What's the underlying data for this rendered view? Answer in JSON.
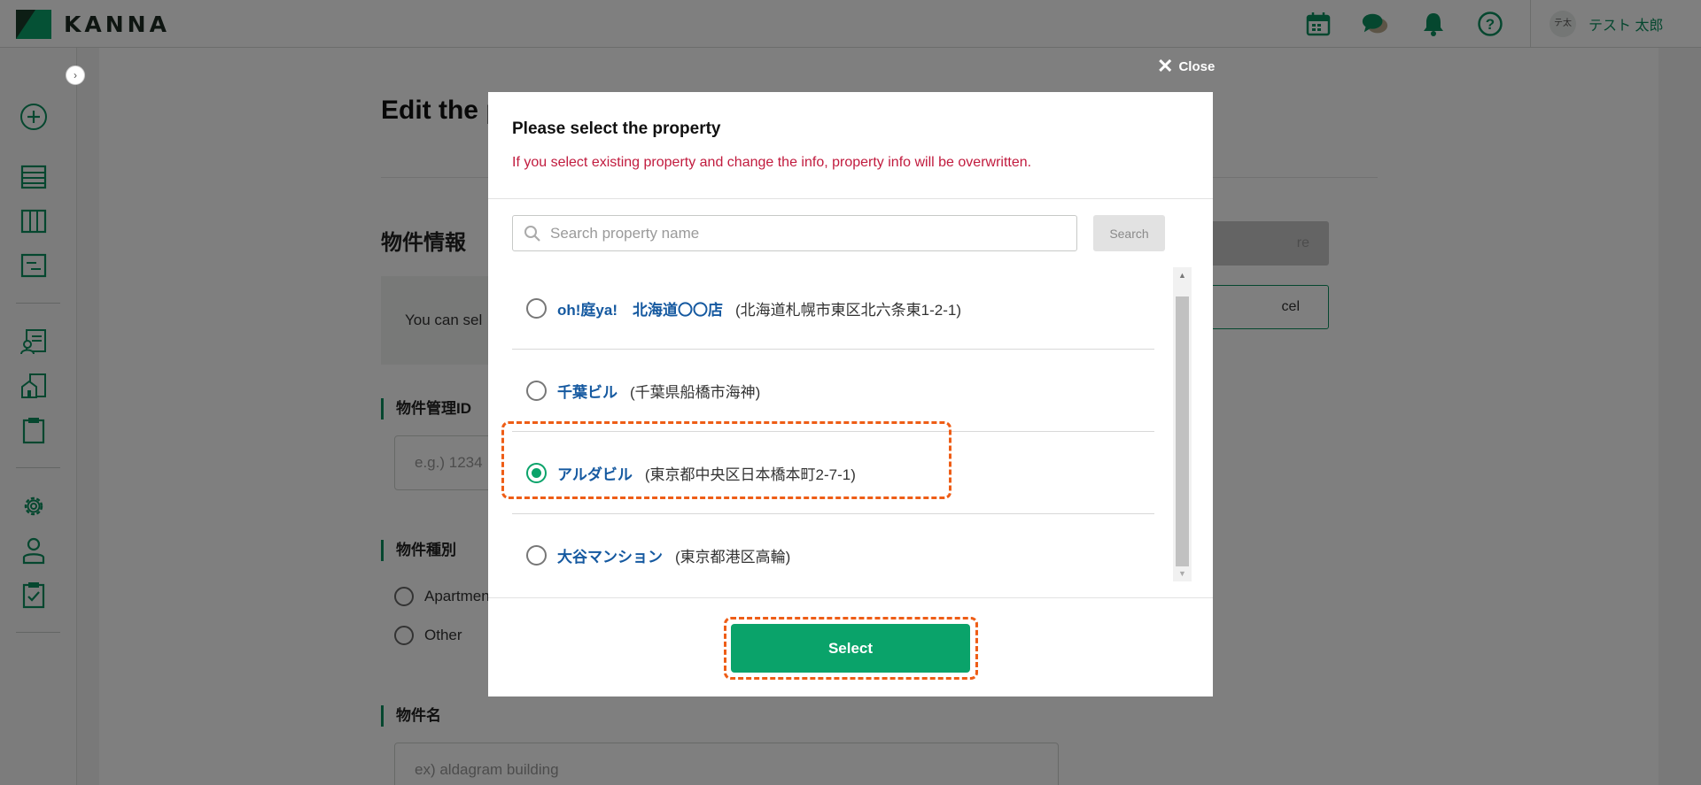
{
  "app": {
    "logo_text": "KANNA"
  },
  "header": {
    "icons": [
      "calendar-icon",
      "chat-icon",
      "bell-icon",
      "help-icon"
    ],
    "user": {
      "avatar_text": "テ太",
      "name": "テスト 太郎"
    }
  },
  "sidebar": {
    "toggle": "›",
    "items": [
      "add-icon",
      "list-icon",
      "board-icon",
      "report-icon",
      "customer-icon",
      "property-icon",
      "clipboard-icon",
      "settings-icon",
      "user-icon",
      "checklist-icon"
    ]
  },
  "page": {
    "title": "Edit the p",
    "section_title": "物件情報",
    "info_text": "You can sel",
    "save_button": "re",
    "cancel_button": "cel",
    "fields": {
      "property_id_label": "物件管理ID",
      "property_id_placeholder": "e.g.) 1234",
      "property_type_label": "物件種別",
      "type_options": [
        "Apartmen",
        "Other"
      ],
      "property_name_label": "物件名",
      "property_name_placeholder": "ex) aldagram building"
    }
  },
  "modal": {
    "close_label": "Close",
    "title": "Please select the property",
    "warning": "If you select existing property and change the info, property info will be overwritten.",
    "search": {
      "placeholder": "Search property name",
      "button": "Search"
    },
    "properties": [
      {
        "name": "oh!庭ya!　北海道〇〇店",
        "address": "(北海道札幌市東区北六条東1-2-1)",
        "selected": false
      },
      {
        "name": "千葉ビル",
        "address": "(千葉県船橋市海神)",
        "selected": false
      },
      {
        "name": "アルダビル",
        "address": "(東京都中央区日本橋本町2-7-1)",
        "selected": true
      },
      {
        "name": "大谷マンション",
        "address": "(東京都港区高輪)",
        "selected": false
      }
    ],
    "select_button": "Select"
  },
  "colors": {
    "brand_green": "#0aa36a",
    "link_blue": "#1559a0",
    "warning_red": "#c11b3e",
    "highlight_orange": "#ee5d16"
  }
}
